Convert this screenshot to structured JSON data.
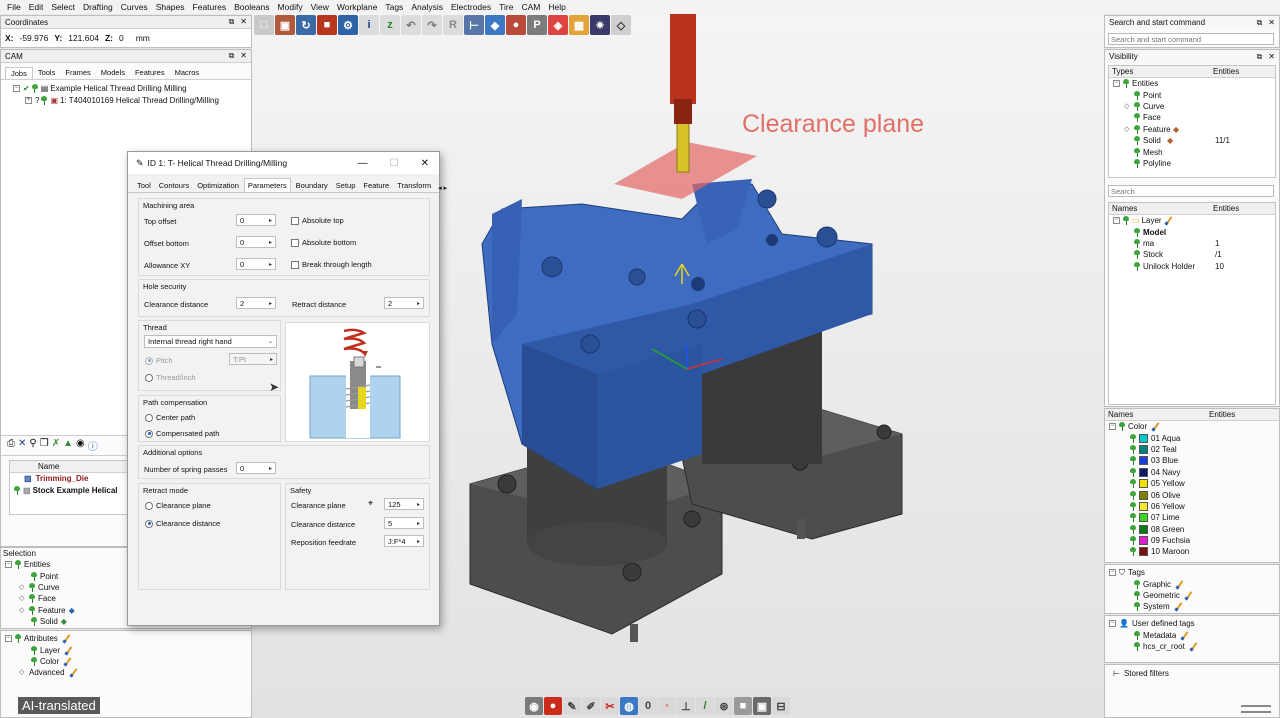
{
  "menu": [
    "File",
    "Edit",
    "Select",
    "Drafting",
    "Curves",
    "Shapes",
    "Features",
    "Booleans",
    "Modify",
    "View",
    "Workplane",
    "Tags",
    "Analysis",
    "Electrodes",
    "Tire",
    "CAM",
    "Help"
  ],
  "coordinates": {
    "title": "Coordinates",
    "x_label": "X:",
    "x_value": "-59.976",
    "y_label": "Y:",
    "y_value": "121.604",
    "z_label": "Z:",
    "z_value": "0",
    "unit": "mm"
  },
  "cam": {
    "title": "CAM",
    "tabs": [
      "Jobs",
      "Tools",
      "Frames",
      "Models",
      "Features",
      "Macros"
    ],
    "job_label": "Example Helical Thread Drilling Milling",
    "op_label": "1: T404010169 Helical Thread Drilling/Milling",
    "list_header": "Name",
    "list_items": [
      "Trimming_Die",
      "Stock Example Helical"
    ]
  },
  "selection": {
    "title": "Selection",
    "entities_label": "Entities",
    "items": [
      "Point",
      "Curve",
      "Face",
      "Feature",
      "Solid"
    ],
    "attributes_label": "Attributes",
    "attr_items": [
      "Layer",
      "Color"
    ],
    "advanced_label": "Advanced"
  },
  "dialog": {
    "title": "ID 1: T- Helical Thread Drilling/Milling",
    "tabs": [
      "Tool",
      "Contours",
      "Optimization",
      "Parameters",
      "Boundary",
      "Setup",
      "Feature",
      "Transform"
    ],
    "machining_area": {
      "label": "Machining area",
      "top_offset_label": "Top offset",
      "top_offset": "0",
      "offset_bottom_label": "Offset bottom",
      "offset_bottom": "0",
      "allowance_label": "Allowance XY",
      "allowance": "0",
      "absolute_top": "Absolute top",
      "absolute_bottom": "Absolute bottom",
      "break_through": "Break through length"
    },
    "hole_security": {
      "label": "Hole security",
      "clearance_label": "Clearance distance",
      "clearance": "2",
      "retract_label": "Retract distance",
      "retract": "2"
    },
    "thread": {
      "label": "Thread",
      "type": "Internal thread right hand",
      "pitch_label": "Pitch",
      "pitch": "T:Pt",
      "tpi_label": "Thread/inch"
    },
    "path_comp": {
      "label": "Path compensation",
      "center": "Center path",
      "compensated": "Compensated path"
    },
    "additional": {
      "label": "Additional options",
      "spring_label": "Number of spring passes",
      "spring": "0"
    },
    "retract_mode": {
      "label": "Retract mode",
      "plane": "Clearance plane",
      "distance": "Clearance distance"
    },
    "safety": {
      "label": "Safety",
      "plane_label": "Clearance plane",
      "plane": "125",
      "distance_label": "Clearance distance",
      "distance": "5",
      "feed_label": "Reposition feedrate",
      "feed": "J:F*4"
    }
  },
  "viewport": {
    "annotation": "Clearance plane"
  },
  "right": {
    "search_title": "Search and start command",
    "search_placeholder": "Search and start command",
    "visibility_title": "Visibility",
    "types_header": "Types",
    "entities_header": "Entities",
    "types": [
      {
        "name": "Entities",
        "count": ""
      },
      {
        "name": "Point",
        "count": ""
      },
      {
        "name": "Curve",
        "count": ""
      },
      {
        "name": "Face",
        "count": ""
      },
      {
        "name": "Feature",
        "count": ""
      },
      {
        "name": "Solid",
        "count": "11/1"
      },
      {
        "name": "Mesh",
        "count": ""
      },
      {
        "name": "Polyline",
        "count": ""
      }
    ],
    "search2_placeholder": "Search",
    "names_header": "Names",
    "layers": [
      {
        "name": "Layer",
        "count": ""
      },
      {
        "name": "Model",
        "count": ""
      },
      {
        "name": "ma",
        "count": "1"
      },
      {
        "name": "Stock",
        "count": "/1"
      },
      {
        "name": "Unilock Holder",
        "count": "10"
      }
    ],
    "colors_label": "Color",
    "colors": [
      {
        "name": "01 Aqua",
        "hex": "#00c8c8"
      },
      {
        "name": "02 Teal",
        "hex": "#008080"
      },
      {
        "name": "03 Blue",
        "hex": "#1e3fd6"
      },
      {
        "name": "04 Navy",
        "hex": "#0a1a6e"
      },
      {
        "name": "05 Yellow",
        "hex": "#f4e000"
      },
      {
        "name": "06 Olive",
        "hex": "#808000"
      },
      {
        "name": "06 Yellow",
        "hex": "#f7ea2a"
      },
      {
        "name": "07 Lime",
        "hex": "#35d81c"
      },
      {
        "name": "08 Green",
        "hex": "#0a7a18"
      },
      {
        "name": "09 Fuchsia",
        "hex": "#e020d0"
      },
      {
        "name": "10 Maroon",
        "hex": "#7a1010"
      }
    ],
    "tags_label": "Tags",
    "tags": [
      "Graphic",
      "Geometric",
      "System"
    ],
    "udt_label": "User defined tags",
    "udt": [
      "Metadata",
      "hcs_cr_root"
    ],
    "stored_filters": "Stored filters"
  },
  "badge": "AI-translated"
}
